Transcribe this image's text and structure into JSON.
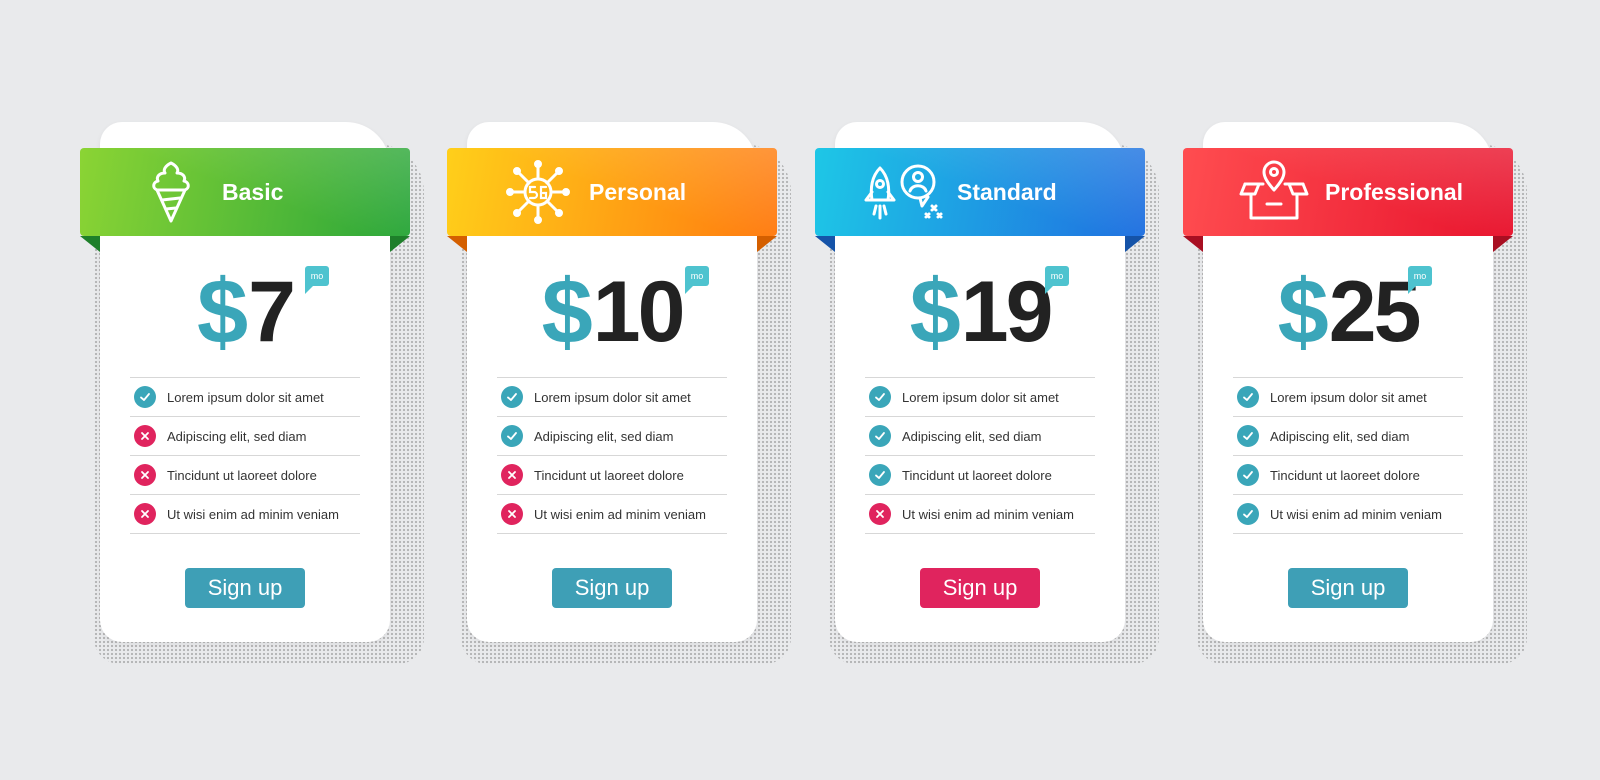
{
  "colors": {
    "check": "#3aa6b9",
    "cross": "#e0245e",
    "dollar": "#3aa6b9",
    "button_default": "#3e9fb6",
    "button_highlight": "#e0245e"
  },
  "currency_symbol": "$",
  "period_label": "mo",
  "plans": [
    {
      "name": "Basic",
      "price": "7",
      "icon": "ice-cream-icon",
      "gradient": [
        "#8bd434",
        "#2aa63a"
      ],
      "fold": "#1e7f2a",
      "button": "Sign up",
      "button_color": "#3e9fb6",
      "features": [
        {
          "text": "Lorem ipsum dolor sit amet",
          "included": true
        },
        {
          "text": "Adipiscing elit, sed diam",
          "included": false
        },
        {
          "text": "Tincidunt ut laoreet dolore",
          "included": false
        },
        {
          "text": "Ut wisi enim ad minim veniam",
          "included": false
        }
      ]
    },
    {
      "name": "Personal",
      "price": "10",
      "icon": "5g-network-icon",
      "gradient": [
        "#ffcf1a",
        "#ff7a0f"
      ],
      "fold": "#d45f00",
      "button": "Sign up",
      "button_color": "#3e9fb6",
      "features": [
        {
          "text": "Lorem ipsum dolor sit amet",
          "included": true
        },
        {
          "text": "Adipiscing elit, sed diam",
          "included": true
        },
        {
          "text": "Tincidunt ut laoreet dolore",
          "included": false
        },
        {
          "text": "Ut wisi enim ad minim veniam",
          "included": false
        }
      ]
    },
    {
      "name": "Standard",
      "price": "19",
      "icon": "startup-rocket-icon",
      "gradient": [
        "#1ec7e6",
        "#1f6fe0"
      ],
      "fold": "#1553a8",
      "button": "Sign up",
      "button_color": "#e0245e",
      "features": [
        {
          "text": "Lorem ipsum dolor sit amet",
          "included": true
        },
        {
          "text": "Adipiscing elit, sed diam",
          "included": true
        },
        {
          "text": "Tincidunt ut laoreet dolore",
          "included": true
        },
        {
          "text": "Ut wisi enim ad minim veniam",
          "included": false
        }
      ]
    },
    {
      "name": "Professional",
      "price": "25",
      "icon": "delivery-box-icon",
      "gradient": [
        "#ff4d50",
        "#e8132d"
      ],
      "fold": "#a80f22",
      "button": "Sign up",
      "button_color": "#3e9fb6",
      "features": [
        {
          "text": "Lorem ipsum dolor sit amet",
          "included": true
        },
        {
          "text": "Adipiscing elit, sed diam",
          "included": true
        },
        {
          "text": "Tincidunt ut laoreet dolore",
          "included": true
        },
        {
          "text": "Ut wisi enim ad minim veniam",
          "included": true
        }
      ]
    }
  ]
}
